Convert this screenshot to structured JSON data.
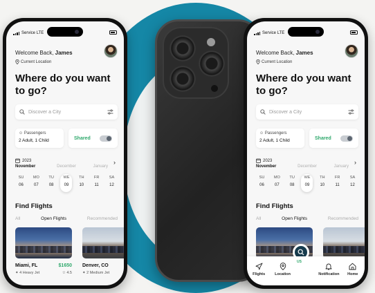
{
  "status": {
    "carrier": "Service",
    "network": "LTE"
  },
  "user": {
    "greeting": "Welcome Back, ",
    "name": "James",
    "location_label": "Current Location"
  },
  "headline": "Where do you want to go?",
  "search": {
    "placeholder": "Discover a City"
  },
  "passengers": {
    "label": "Passengers",
    "value": "2 Adult, 1 Child"
  },
  "shared": {
    "label": "Shared"
  },
  "calendar": {
    "year": "2023",
    "months": [
      "November",
      "December",
      "January"
    ],
    "days": [
      {
        "dow": "SU",
        "date": "06"
      },
      {
        "dow": "MO",
        "date": "07"
      },
      {
        "dow": "TU",
        "date": "08"
      },
      {
        "dow": "WE",
        "date": "09",
        "selected": true
      },
      {
        "dow": "TH",
        "date": "10"
      },
      {
        "dow": "FR",
        "date": "11"
      },
      {
        "dow": "SA",
        "date": "12"
      }
    ]
  },
  "find_flights": {
    "title": "Find Flights",
    "tabs": [
      "All",
      "Open Flights",
      "Recommended"
    ],
    "cards": [
      {
        "city": "Miami, FL",
        "price": "$1650",
        "jet": "4 Heavy Jet",
        "rating": "4.5"
      },
      {
        "city": "Denver, CO",
        "price": "$1",
        "jet": "2 Medium Jet",
        "rating": ""
      }
    ]
  },
  "bottom_nav": {
    "items": [
      "Flights",
      "Location",
      "Notification",
      "Home"
    ],
    "fab_label": "US"
  },
  "colors": {
    "accent_green": "#2ea86b",
    "brand_teal": "#1587a6",
    "fab_navy": "#163b4d"
  }
}
